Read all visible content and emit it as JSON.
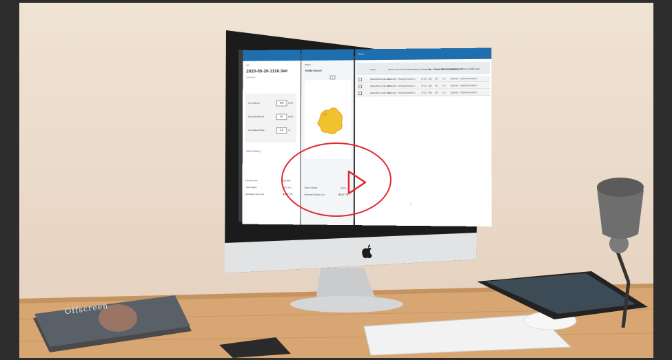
{
  "screen": {
    "left_panel": {
      "header": "Info",
      "title": "2020-05-26-1116.3wl",
      "subtitle": "(1 item(s))",
      "fields": [
        {
          "label": "New Material",
          "value": "300",
          "unit": "[g/%]"
        },
        {
          "label": "Recycled Material",
          "value": "90",
          "unit": "[g/%]"
        },
        {
          "label": "New Material Rate",
          "value": "0.8",
          "unit": "%"
        }
      ],
      "link": "View History",
      "stats": [
        {
          "label": "Printing Time",
          "value": "02h 58m"
        },
        {
          "label": "Total Weight",
          "value": "1572.54 g"
        },
        {
          "label": "Estimated Total Cost",
          "value": "$347.74"
        }
      ]
    },
    "middle_panel": {
      "header": "Object",
      "title": "Teddy-key.stl",
      "pager": "1",
      "stats": [
        {
          "label": "Object Weight",
          "value": "3.00 g"
        },
        {
          "label": "Estimated Object Cost",
          "value": "$347.74"
        }
      ]
    },
    "right_panel": {
      "header": "History",
      "columns": [
        "Name",
        "Printer Name",
        "Printer Status",
        "Material",
        "Weight (g)",
        "New Material (g)",
        "Recycled Material (g)",
        "New Material Rate (%)",
        "Print Date",
        "Printing Time",
        "Remarks"
      ],
      "rows": [
        [
          "2020-05-26-1116.3wl",
          "3DtechS",
          "Printing Finished",
          "1",
          "273.5",
          "300",
          "90",
          "0.8",
          "2020-05",
          "2020-05-26",
          "02h 5"
        ],
        [
          "2020-05-21-1716.3wl",
          "3DtechS",
          "Printing Finished",
          "1",
          "273.2",
          "300",
          "90",
          "0.8",
          "2020-05",
          "2020-05-21",
          "02h 2"
        ],
        [
          "2020-05-21-1511.3wl",
          "3DtechS",
          "Printing Finished",
          "1",
          "273.1",
          "300",
          "90",
          "0.8",
          "2020-05",
          "2020-05-21",
          "02h 1"
        ]
      ],
      "pagination": "1"
    }
  },
  "magazine": {
    "title": "Offscreen"
  },
  "colors": {
    "play_accent": "#e0282e",
    "app_header": "#1f6faf",
    "model": "#f2c12e"
  }
}
